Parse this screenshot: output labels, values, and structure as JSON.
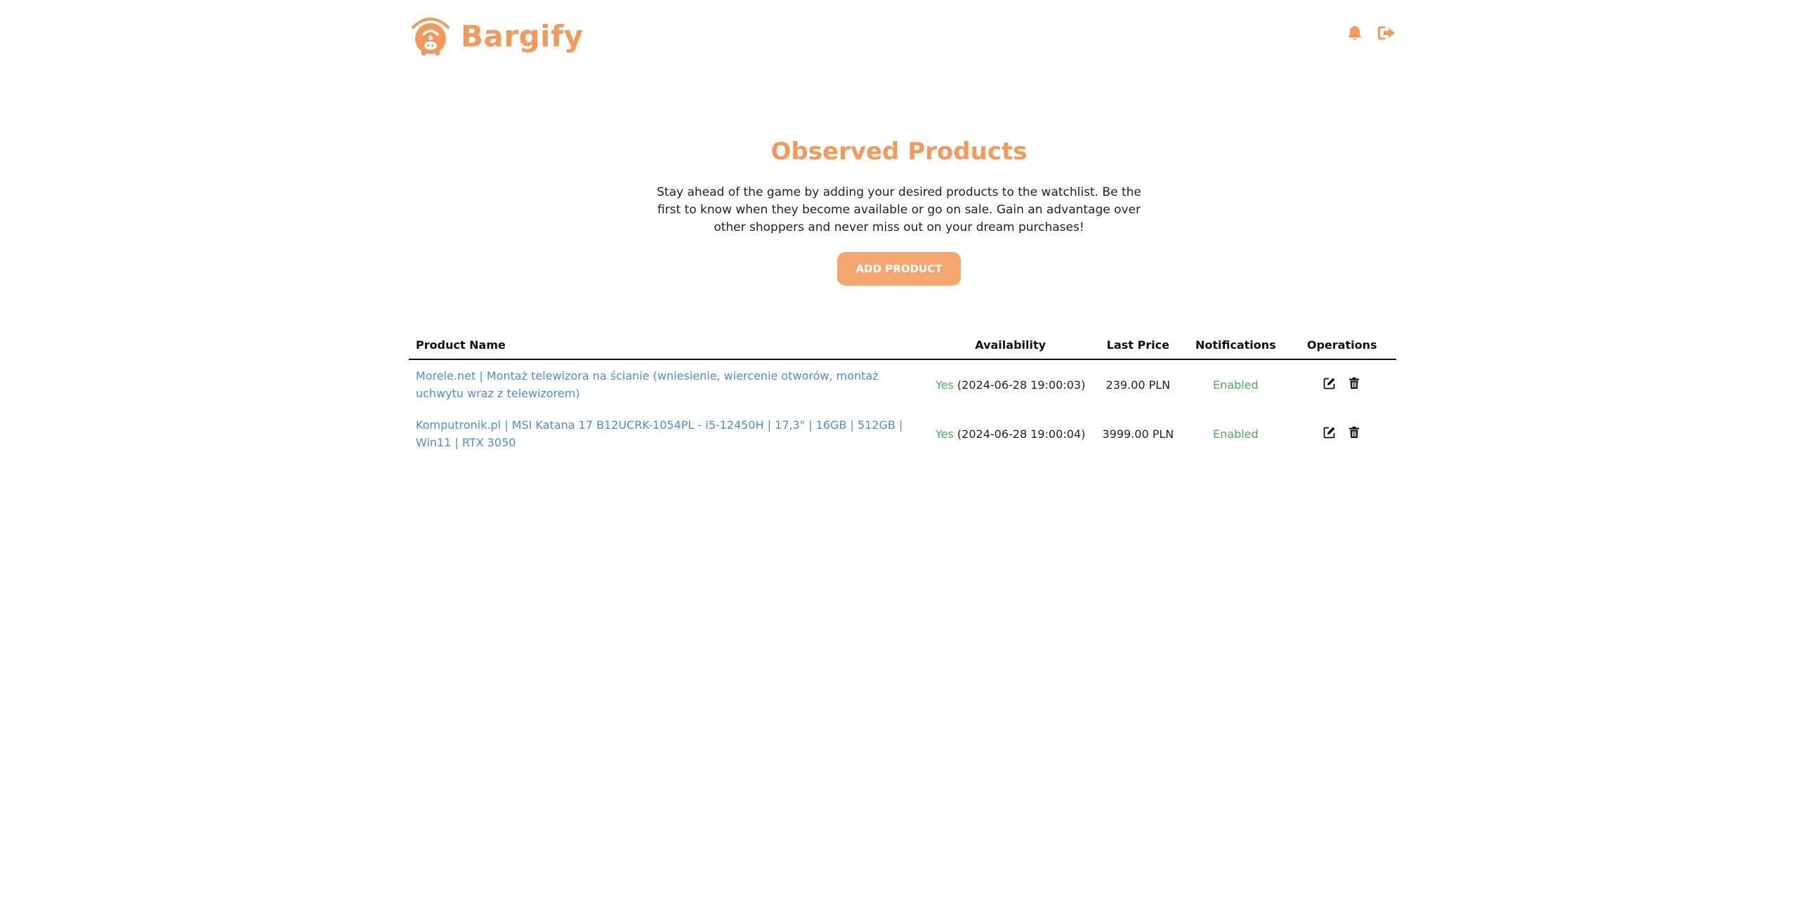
{
  "brand": {
    "name": "Bargify",
    "accent_color": "#f2995c"
  },
  "header": {
    "icons": [
      "bell-icon",
      "logout-icon"
    ]
  },
  "hero": {
    "title": "Observed Products",
    "description": "Stay ahead of the game by adding your desired products to the watchlist. Be the first to know when they become available or go on sale. Gain an advantage over other shoppers and never miss out on your dream purchases!",
    "add_button_label": "ADD PRODUCT"
  },
  "table": {
    "headers": {
      "name": "Product Name",
      "availability": "Availability",
      "price": "Last Price",
      "notifications": "Notifications",
      "operations": "Operations"
    },
    "rows": [
      {
        "name": "Morele.net | Montaż telewizora na ścianie (wniesienie, wiercenie otworów, montaż uchwytu wraz z telewizorem)",
        "available": "Yes",
        "checked": "(2024-06-28 19:00:03)",
        "price": "239.00 PLN",
        "notifications": "Enabled"
      },
      {
        "name": "Komputronik.pl | MSI Katana 17 B12UCRK-1054PL - i5-12450H | 17,3\" | 16GB | 512GB | Win11 | RTX 3050",
        "available": "Yes",
        "checked": "(2024-06-28 19:00:04)",
        "price": "3999.00 PLN",
        "notifications": "Enabled"
      }
    ]
  }
}
